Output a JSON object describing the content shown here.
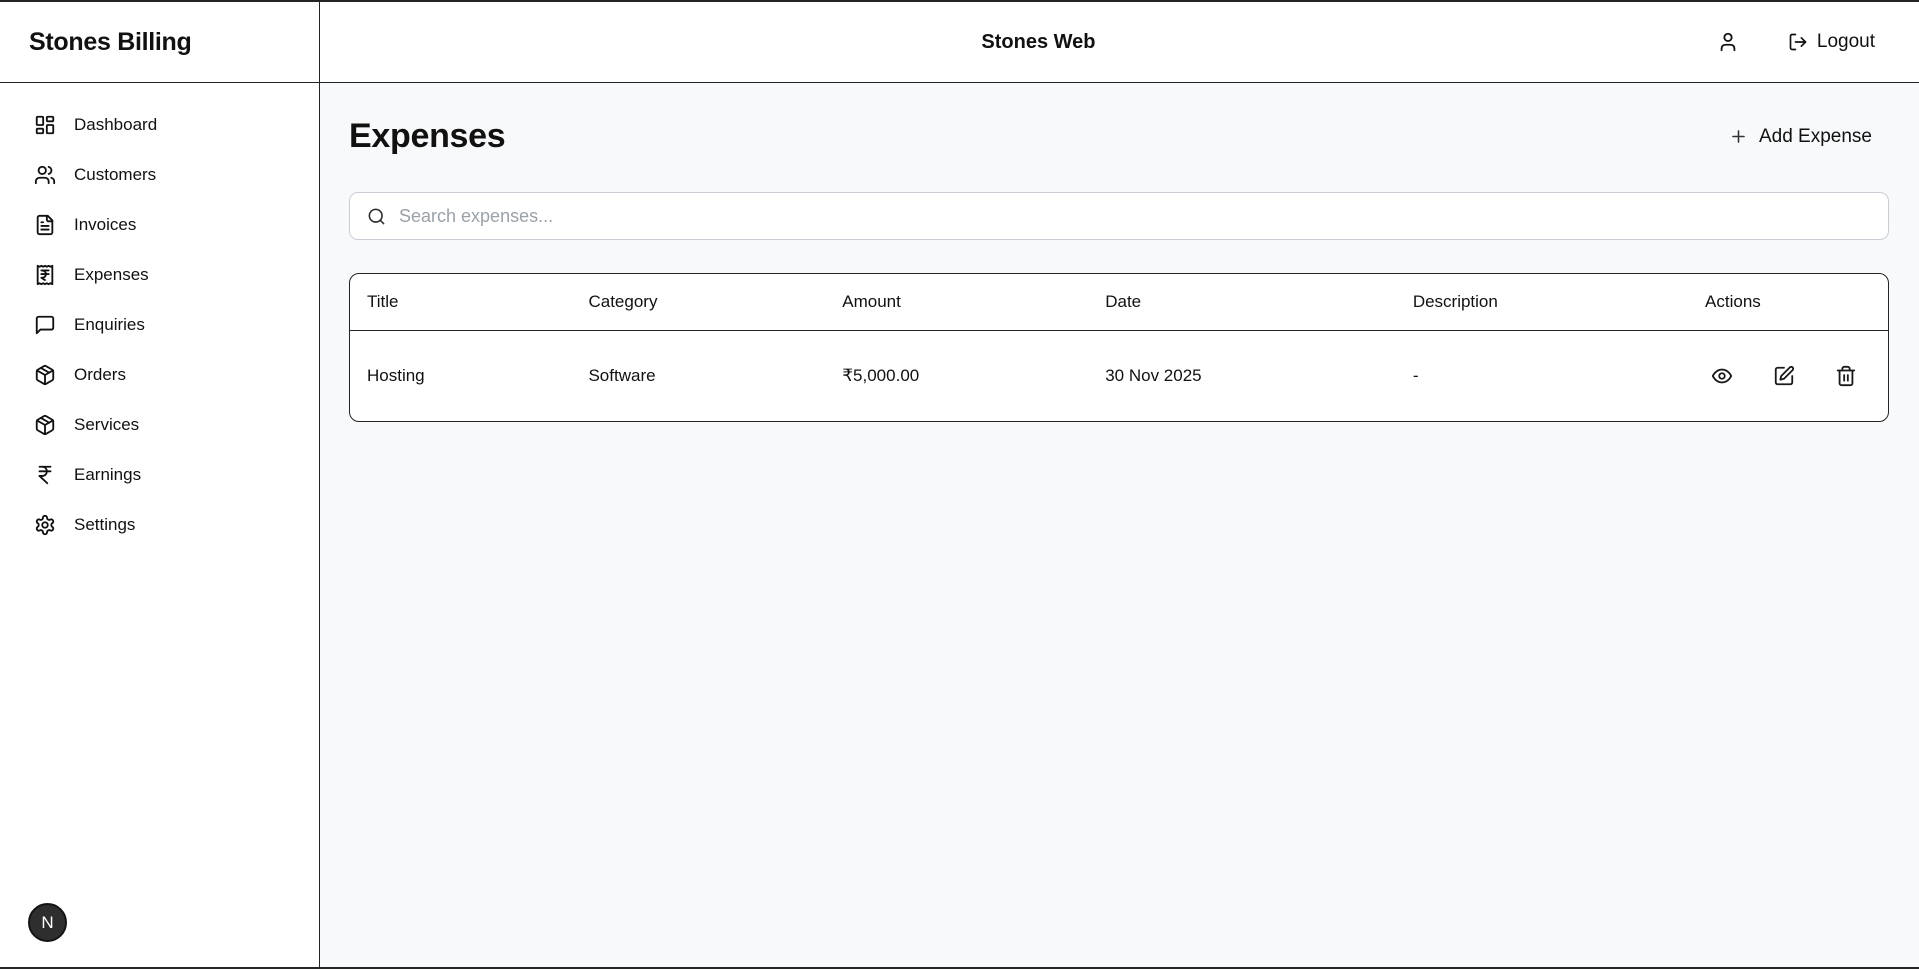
{
  "app": {
    "sidebar_title": "Stones Billing",
    "header_title": "Stones Web",
    "logout_label": "Logout",
    "avatar_initial": "N"
  },
  "sidebar": {
    "items": [
      {
        "label": "Dashboard",
        "icon": "dashboard"
      },
      {
        "label": "Customers",
        "icon": "users"
      },
      {
        "label": "Invoices",
        "icon": "file-text"
      },
      {
        "label": "Expenses",
        "icon": "receipt-rupee"
      },
      {
        "label": "Enquiries",
        "icon": "message-square"
      },
      {
        "label": "Orders",
        "icon": "package"
      },
      {
        "label": "Services",
        "icon": "package"
      },
      {
        "label": "Earnings",
        "icon": "rupee"
      },
      {
        "label": "Settings",
        "icon": "gear"
      }
    ]
  },
  "page": {
    "title": "Expenses",
    "add_button_label": "Add Expense",
    "search_placeholder": "Search expenses...",
    "search_value": ""
  },
  "table": {
    "columns": [
      {
        "key": "title",
        "label": "Title",
        "width": "14.4%"
      },
      {
        "key": "category",
        "label": "Category",
        "width": "16.5%"
      },
      {
        "key": "amount",
        "label": "Amount",
        "width": "17.1%"
      },
      {
        "key": "date",
        "label": "Date",
        "width": "20%"
      },
      {
        "key": "description",
        "label": "Description",
        "width": "19%"
      },
      {
        "key": "actions",
        "label": "Actions",
        "width": "13%"
      }
    ],
    "rows": [
      {
        "title": "Hosting",
        "category": "Software",
        "amount": "₹5,000.00",
        "date": "30 Nov 2025",
        "description": "-"
      }
    ],
    "row_actions": [
      {
        "name": "view",
        "icon": "eye"
      },
      {
        "name": "edit",
        "icon": "square-pen"
      },
      {
        "name": "delete",
        "icon": "trash"
      }
    ]
  },
  "colors": {
    "page_bg": "#f8f9fa",
    "surface": "#ffffff",
    "border_dark": "#242424",
    "border_input": "#c9ced4",
    "text": "#111111",
    "placeholder": "#9aa1a8",
    "avatar_bg": "#2e2e2e",
    "avatar_text": "#ffffff"
  }
}
